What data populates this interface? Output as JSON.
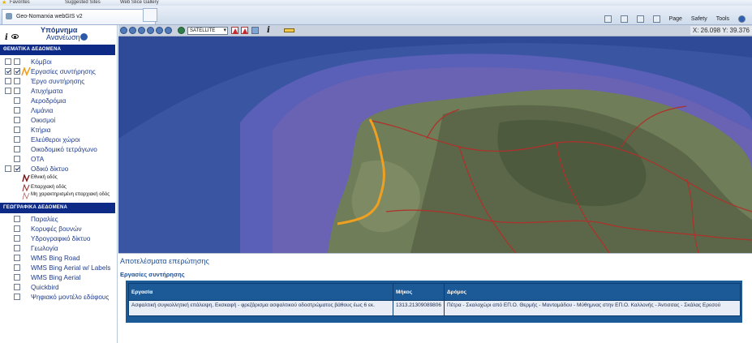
{
  "browser": {
    "favorites_bar": {
      "favorites_label": "Favorites",
      "suggested_sites_label": "Suggested Sites",
      "web_slice_label": "Web Slice Gallery"
    },
    "tab_title": "Geo-Nomarxia webGIS v2",
    "command_bar": {
      "page_label": "Page",
      "safety_label": "Safety",
      "tools_label": "Tools"
    }
  },
  "legend": {
    "title": "Υπόμνημα",
    "refresh_label": "Ανανέωση",
    "thematic_header": "ΘΕΜΑΤΙΚΑ ΔΕΔΟΜΕΝΑ",
    "thematic_layers": [
      {
        "label": "Κόμβοι",
        "checked_a": false,
        "checked_b": false
      },
      {
        "label": "Εργασίες συντήρησης",
        "checked_a": true,
        "checked_b": true
      },
      {
        "label": "Έργο συντήρησης",
        "checked_a": false,
        "checked_b": false
      },
      {
        "label": "Ατυχήματα",
        "checked_a": false,
        "checked_b": false
      },
      {
        "label": "Αεροδρόμια",
        "checked_b": false
      },
      {
        "label": "Λιμάνια",
        "checked_b": false
      },
      {
        "label": "Οικισμοί",
        "checked_b": false
      },
      {
        "label": "Κτήρια",
        "checked_b": false
      },
      {
        "label": "Ελεύθεροι χώροι",
        "checked_b": false
      },
      {
        "label": "Οικοδομικό τετράγωνο",
        "checked_b": false
      },
      {
        "label": "ΟΤΑ",
        "checked_b": false
      },
      {
        "label": "Οδικό δίκτυο",
        "checked_a": false,
        "checked_b": true
      }
    ],
    "road_legend": [
      {
        "label": "Εθνική οδός",
        "color": "#7a0e0e"
      },
      {
        "label": "Επαρχιακή οδός",
        "color": "#9a2a2a"
      },
      {
        "label": "Μη χαρακτηρισμένη επαρχιακή οδός",
        "color": "#b86060"
      }
    ],
    "geographic_header": "ΓΕΩΓΡΑΦΙΚΑ ΔΕΔΟΜΕΝΑ",
    "geographic_layers": [
      {
        "label": "Παραλίες",
        "checked": false
      },
      {
        "label": "Κορυφές βουνών",
        "checked": false
      },
      {
        "label": "Υδρογραφικό δίκτυο",
        "checked": false
      },
      {
        "label": "Γεωλογία",
        "checked": false
      },
      {
        "label": "WMS Bing Road",
        "checked": false
      },
      {
        "label": "WMS Bing Aerial w/ Labels",
        "checked": false
      },
      {
        "label": "WMS Bing Aerial",
        "checked": false
      },
      {
        "label": "Quickbird",
        "checked": false
      },
      {
        "label": "Ψηφιακό μοντέλο εδάφους",
        "checked": false
      }
    ]
  },
  "map": {
    "layer_select_value": "SATELLITE",
    "coordinates": "X: 26.098 Y: 39.376",
    "colors": {
      "sea_deep": "#3a56a2",
      "sea_shallow": "#5a5fb8",
      "land": "#6f7d58",
      "road": "#b0302b",
      "maintenance_work": "#f0a020"
    }
  },
  "results": {
    "title": "Αποτελέσματα επερώτησης",
    "subtitle": "Εργασίες συντήρησης",
    "columns": [
      "Εργασία",
      "Μήκος",
      "Δρόμος"
    ],
    "rows": [
      {
        "work": "Ασφαλτική συγκολλητική επάλειψη, Εκσκαφή - φρεζάρισμα ασφαλτικού οδοστρώματος βάθους έως 6 εκ.",
        "length": "1313.21309089806",
        "road": "Πέτρα - Σκαλοχώρι από ΕΠ.Ο. Θερμής - Μανταμάδου - Μύθημνας στην ΕΠ.Ο. Καλλονής - Άντισσας - Σκάλας Ερεσού"
      }
    ]
  }
}
